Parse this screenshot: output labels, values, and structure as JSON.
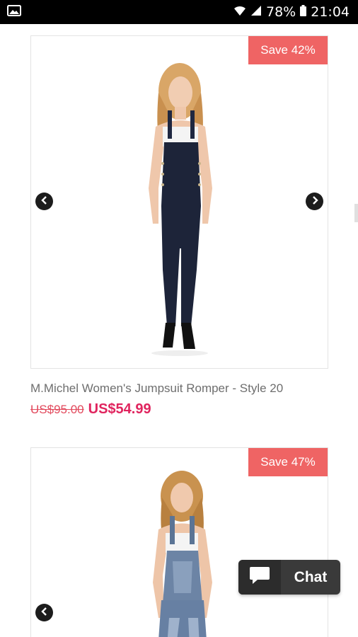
{
  "status_bar": {
    "battery": "78%",
    "time": "21:04"
  },
  "products": [
    {
      "badge": "Save 42%",
      "title": "M.Michel Women's Jumpsuit Romper - Style 20",
      "old_price": "US$95.00",
      "new_price": "US$54.99"
    },
    {
      "badge": "Save 47%"
    }
  ],
  "chat": {
    "label": "Chat"
  },
  "colors": {
    "badge": "#ef6464",
    "price": "#e0245e",
    "chat_bg": "#3a3a3a"
  },
  "icons": [
    "gallery-icon",
    "wifi-icon",
    "signal-icon",
    "battery-icon",
    "chevron-left-icon",
    "chevron-right-icon",
    "chat-bubble-icon"
  ]
}
